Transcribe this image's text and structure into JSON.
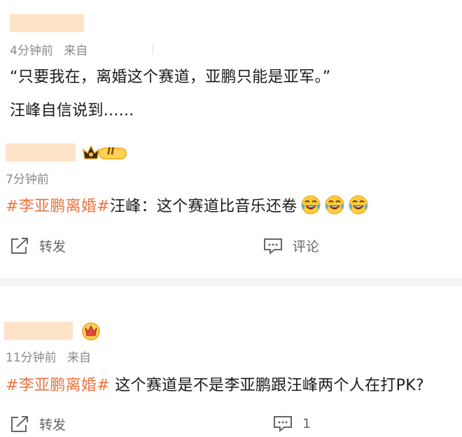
{
  "post1": {
    "time": "4分钟前",
    "source_prefix": "来自",
    "quote": "“只要我在，离婚这个赛道，亚鹏只能是亚军。”",
    "text": "汪峰自信说到......"
  },
  "post2": {
    "badge_level": "II",
    "time": "7分钟前",
    "hashtag": "#李亚鹏离婚#",
    "text": "汪峰：这个赛道比音乐还卷",
    "emoji": [
      "laugh-cry",
      "laugh-cry",
      "laugh-cry"
    ],
    "actions": {
      "repost": "转发",
      "comment": "评论"
    }
  },
  "post3": {
    "time": "11分钟前",
    "source_prefix": "来自",
    "hashtag": "#李亚鹏离婚#",
    "text": " 这个赛道是不是李亚鹏跟汪峰两个人在打PK?",
    "actions": {
      "repost": "转发",
      "comment_count": "1"
    }
  },
  "colors": {
    "hashtag": "#eb7340",
    "meta": "#8a8a8a",
    "divider": "#f4f4f4"
  }
}
